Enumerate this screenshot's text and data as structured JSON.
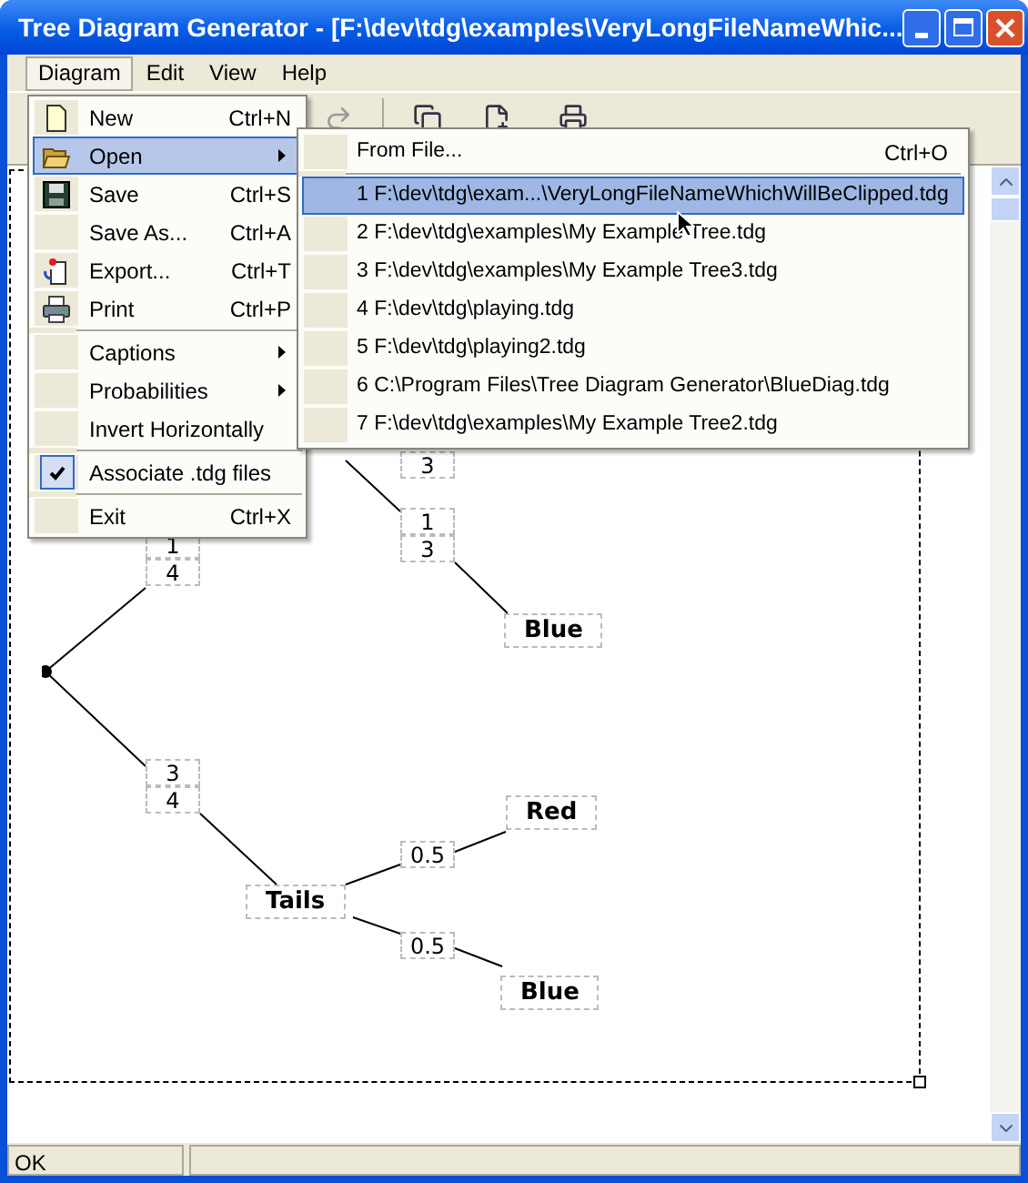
{
  "window": {
    "title": "Tree Diagram Generator - [F:\\dev\\tdg\\examples\\VeryLongFileNameWhic..."
  },
  "menubar": [
    {
      "label": "Diagram",
      "selected": true
    },
    {
      "label": "Edit",
      "selected": false
    },
    {
      "label": "View",
      "selected": false
    },
    {
      "label": "Help",
      "selected": false
    }
  ],
  "diagram_menu": [
    {
      "kind": "item",
      "label": "New",
      "shortcut": "Ctrl+N",
      "selected": false
    },
    {
      "kind": "submenu",
      "label": "Open",
      "selected": true
    },
    {
      "kind": "item",
      "label": "Save",
      "shortcut": "Ctrl+S",
      "selected": false
    },
    {
      "kind": "item",
      "label": "Save As...",
      "shortcut": "Ctrl+A",
      "selected": false
    },
    {
      "kind": "item",
      "label": "Export...",
      "shortcut": "Ctrl+T",
      "selected": false
    },
    {
      "kind": "item",
      "label": "Print",
      "shortcut": "Ctrl+P",
      "selected": false
    },
    {
      "kind": "separator"
    },
    {
      "kind": "submenu",
      "label": "Captions",
      "selected": false
    },
    {
      "kind": "submenu",
      "label": "Probabilities",
      "selected": false
    },
    {
      "kind": "item",
      "label": "Invert Horizontally",
      "selected": false
    },
    {
      "kind": "separator"
    },
    {
      "kind": "check",
      "label": "Associate .tdg files",
      "checked": true,
      "selected": false
    },
    {
      "kind": "separator"
    },
    {
      "kind": "item",
      "label": "Exit",
      "shortcut": "Ctrl+X",
      "selected": false
    }
  ],
  "open_submenu": [
    {
      "kind": "item",
      "label": "From File...",
      "shortcut": "Ctrl+O",
      "selected": false
    },
    {
      "kind": "separator"
    },
    {
      "kind": "item",
      "label": "1 F:\\dev\\tdg\\exam...\\VeryLongFileNameWhichWillBeClipped.tdg",
      "selected": true
    },
    {
      "kind": "item",
      "label": "2 F:\\dev\\tdg\\examples\\My Example Tree.tdg",
      "selected": false
    },
    {
      "kind": "item",
      "label": "3 F:\\dev\\tdg\\examples\\My Example Tree3.tdg",
      "selected": false
    },
    {
      "kind": "item",
      "label": "4 F:\\dev\\tdg\\playing.tdg",
      "selected": false
    },
    {
      "kind": "item",
      "label": "5 F:\\dev\\tdg\\playing2.tdg",
      "selected": false
    },
    {
      "kind": "item",
      "label": "6 C:\\Program Files\\Tree Diagram Generator\\BlueDiag.tdg",
      "selected": false
    },
    {
      "kind": "item",
      "label": "7 F:\\dev\\tdg\\examples\\My Example Tree2.tdg",
      "selected": false
    }
  ],
  "diagram": {
    "nodes": [
      {
        "kind": "outcome",
        "label": "Blue"
      },
      {
        "kind": "outcome",
        "label": "Tails"
      },
      {
        "kind": "outcome",
        "label": "Red"
      },
      {
        "kind": "outcome",
        "label": "Blue"
      }
    ],
    "probabilities": [
      {
        "kind": "single",
        "value": "3"
      },
      {
        "kind": "fraction",
        "numerator": "1",
        "denominator": "3"
      },
      {
        "kind": "fraction",
        "numerator": "1",
        "denominator": "4"
      },
      {
        "kind": "fraction",
        "numerator": "3",
        "denominator": "4"
      },
      {
        "kind": "single",
        "value": "0.5"
      },
      {
        "kind": "single",
        "value": "0.5"
      }
    ]
  },
  "status_bar": {
    "text": "OK"
  }
}
